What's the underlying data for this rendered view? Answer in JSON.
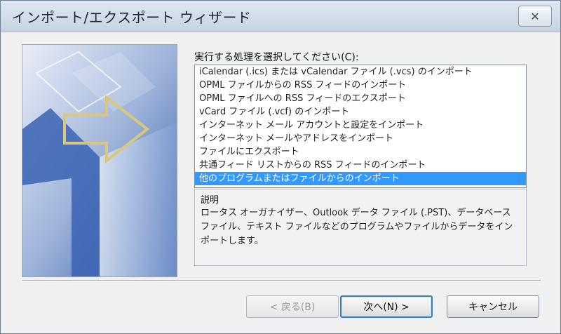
{
  "window": {
    "title": "インポート/エクスポート ウィザード",
    "close_icon": "close-icon"
  },
  "instruction": "実行する処理を選択してください(C):",
  "actions": [
    {
      "label": "iCalendar (.ics) または vCalendar ファイル (.vcs) のインポート",
      "selected": false
    },
    {
      "label": "OPML ファイルからの RSS フィードのインポート",
      "selected": false
    },
    {
      "label": "OPML ファイルへの RSS フィードのエクスポート",
      "selected": false
    },
    {
      "label": "vCard ファイル (.vcf) のインポート",
      "selected": false
    },
    {
      "label": "インターネット メール アカウントと設定をインポート",
      "selected": false
    },
    {
      "label": "インターネット メールやアドレスをインポート",
      "selected": false
    },
    {
      "label": "ファイルにエクスポート",
      "selected": false
    },
    {
      "label": "共通フィード リストからの RSS フィードのインポート",
      "selected": false
    },
    {
      "label": "他のプログラムまたはファイルからのインポート",
      "selected": true
    }
  ],
  "description": {
    "label": "説明",
    "text": "ロータス オーガナイザー、Outlook データ ファイル (.PST)、データベース ファイル、テキスト ファイルなどのプログラムやファイルからデータをインポートします。"
  },
  "buttons": {
    "back": "< 戻る(B)",
    "next": "次へ(N) >",
    "cancel": "キャンセル"
  },
  "colors": {
    "selection": "#3399ff",
    "wizard_blue": "#2f57a8"
  }
}
